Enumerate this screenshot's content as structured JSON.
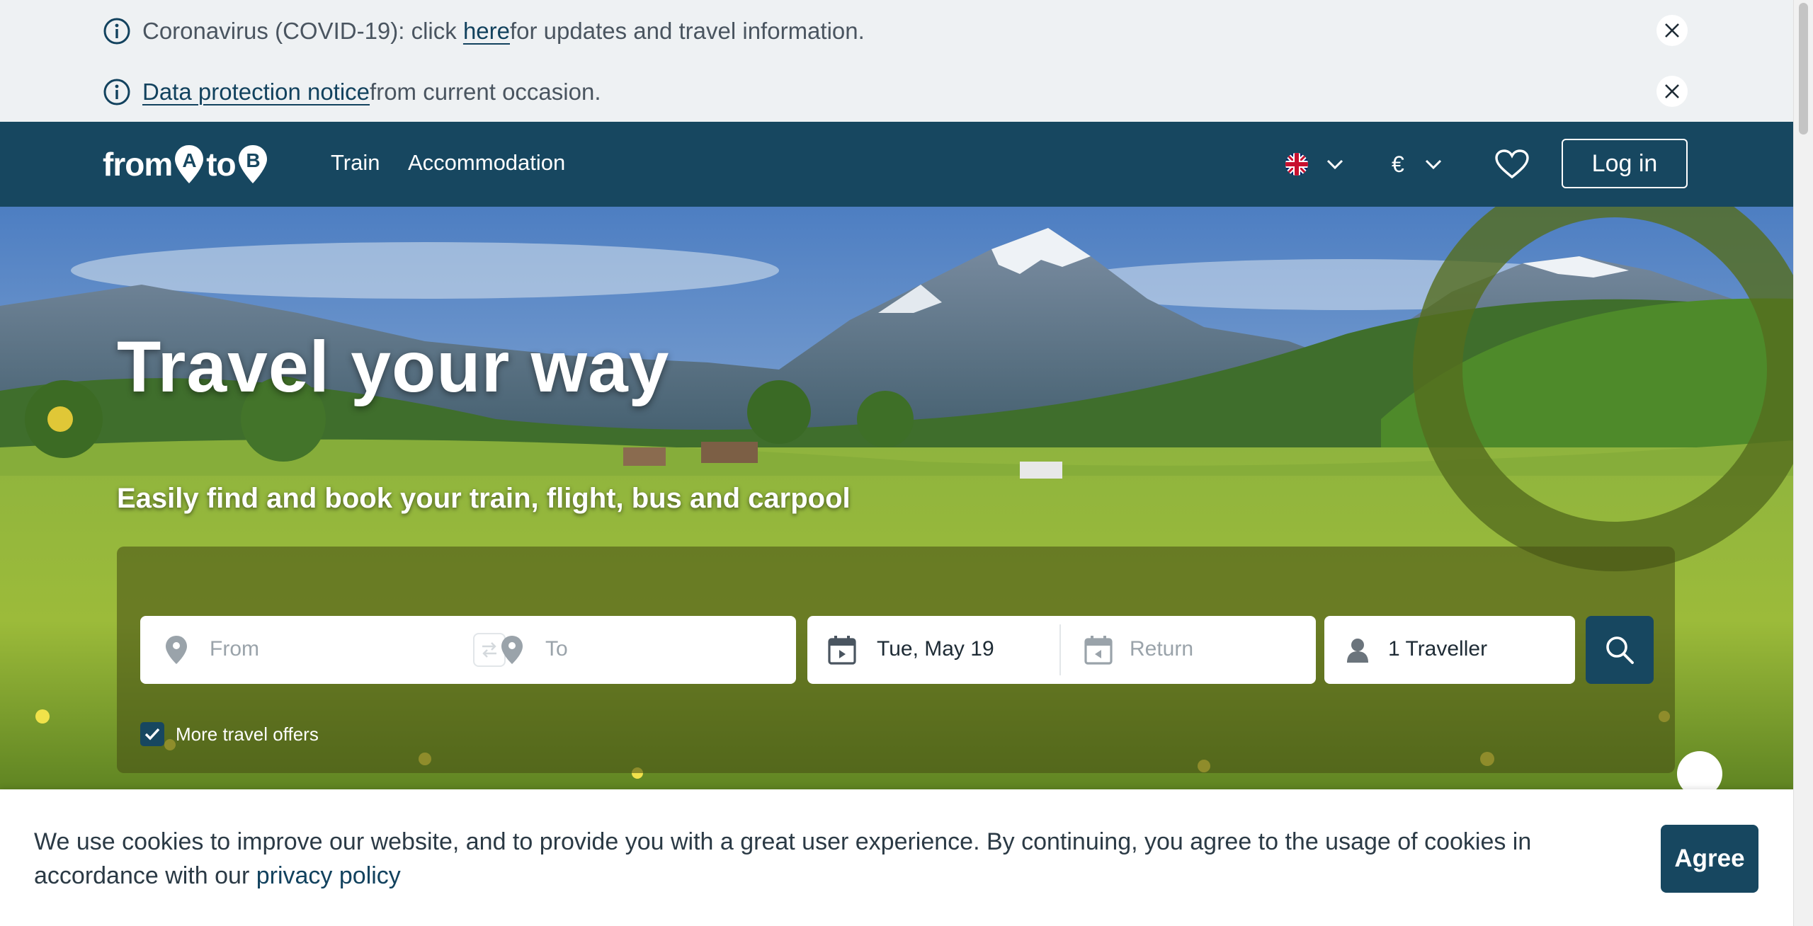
{
  "notices": [
    {
      "prefix": "Coronavirus (COVID-19): click ",
      "link": "here",
      "suffix": " for updates and travel information."
    },
    {
      "prefix": "",
      "link": "Data protection notice",
      "suffix": " from current occasion."
    }
  ],
  "header": {
    "logo": {
      "from": "from",
      "a": "A",
      "to": "to",
      "b": "B"
    },
    "nav": [
      "Train",
      "Accommodation"
    ],
    "language_flag": "uk-flag-icon",
    "currency": "€",
    "login_label": "Log in"
  },
  "hero": {
    "title": "Travel your way",
    "subtitle": "Easily find and book your train, flight, bus and carpool"
  },
  "search": {
    "from_placeholder": "From",
    "to_placeholder": "To",
    "depart_value": "Tue, May 19",
    "return_placeholder": "Return",
    "travellers_value": "1 Traveller",
    "more_offers_label": "More travel offers",
    "more_offers_checked": true
  },
  "cookie": {
    "text": "We use cookies to improve our website, and to provide you with a great user experience. By continuing, you agree to the usage of cookies in accordance with our ",
    "link": "privacy policy",
    "agree_label": "Agree"
  },
  "colors": {
    "brand": "#174760",
    "notice_bg": "#eef1f3",
    "link": "#12425e"
  }
}
